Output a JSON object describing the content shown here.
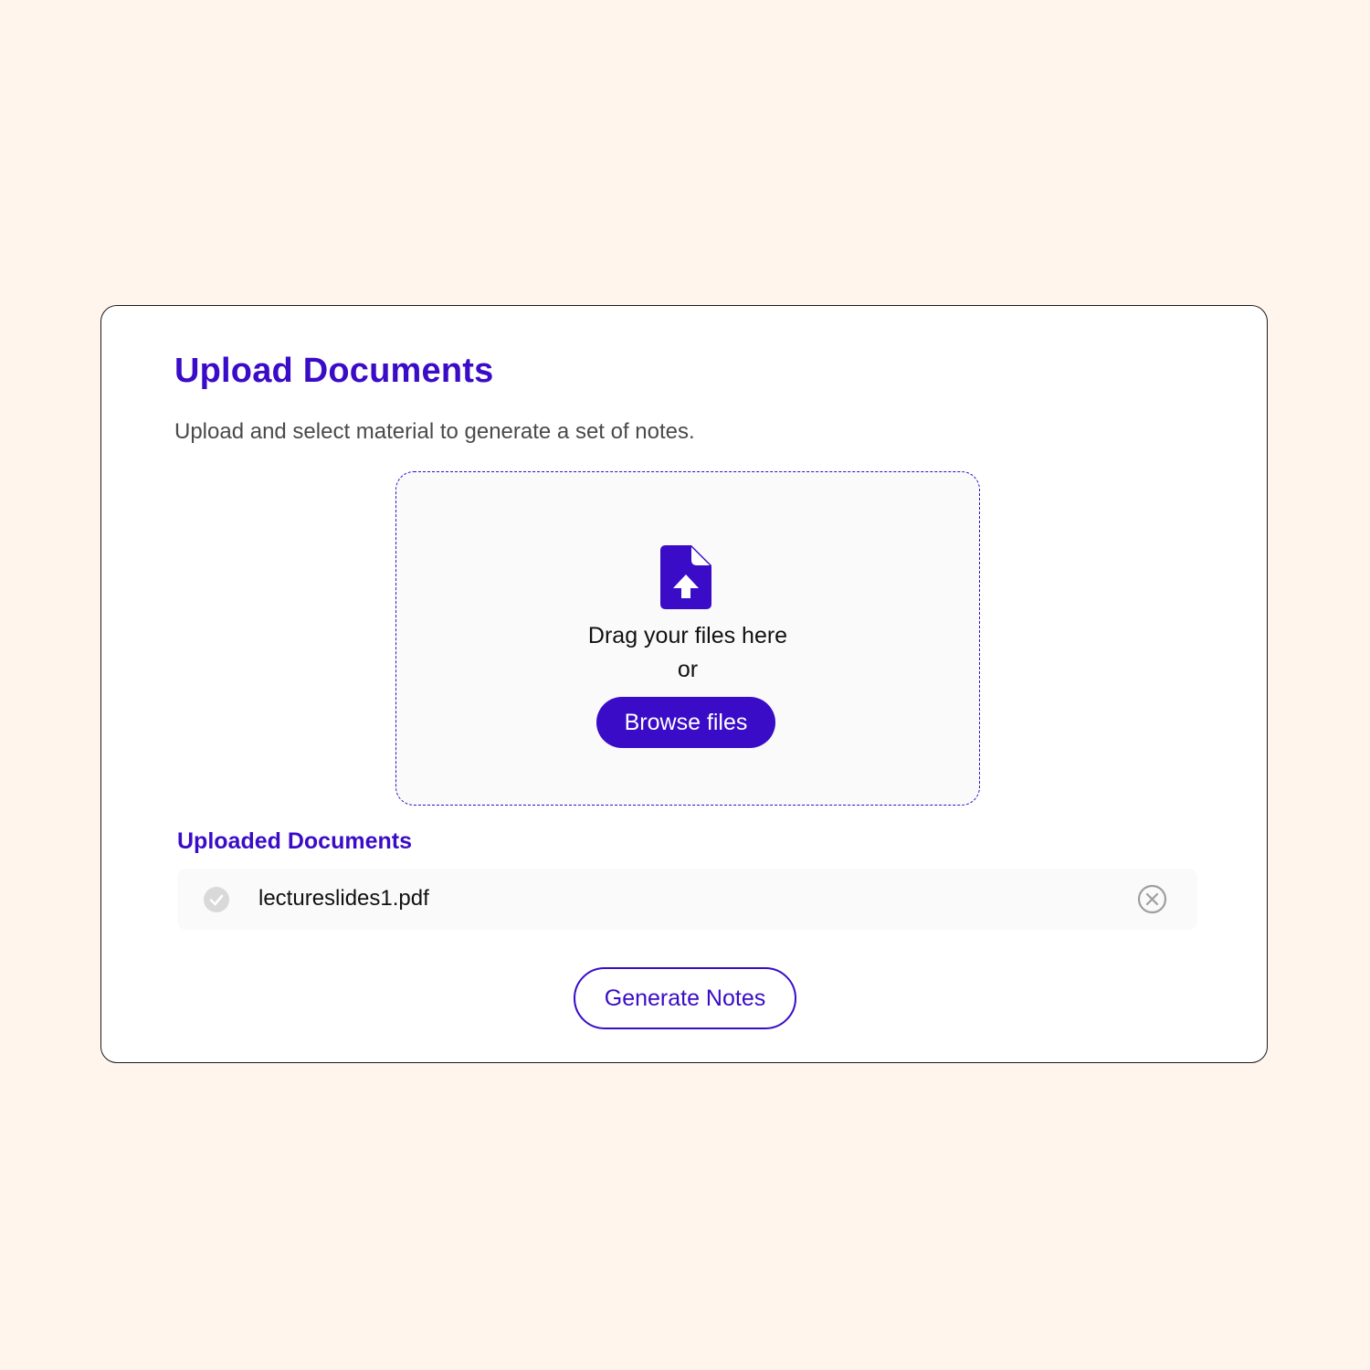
{
  "header": {
    "title": "Upload Documents",
    "subtitle": "Upload and select material to generate a set of notes."
  },
  "dropzone": {
    "icon": "file-upload-icon",
    "drag_text": "Drag your files here",
    "or_text": "or",
    "browse_label": "Browse files"
  },
  "uploaded": {
    "heading": "Uploaded Documents",
    "files": [
      {
        "name": "lectureslides1.pdf",
        "status_icon": "check-circle-icon",
        "remove_icon": "close-circle-icon"
      }
    ]
  },
  "actions": {
    "generate_label": "Generate Notes"
  },
  "colors": {
    "background": "#FFF5EC",
    "accent": "#3A0CC7",
    "card": "#FFFFFF",
    "dropzone_bg": "#FAFAFA"
  }
}
